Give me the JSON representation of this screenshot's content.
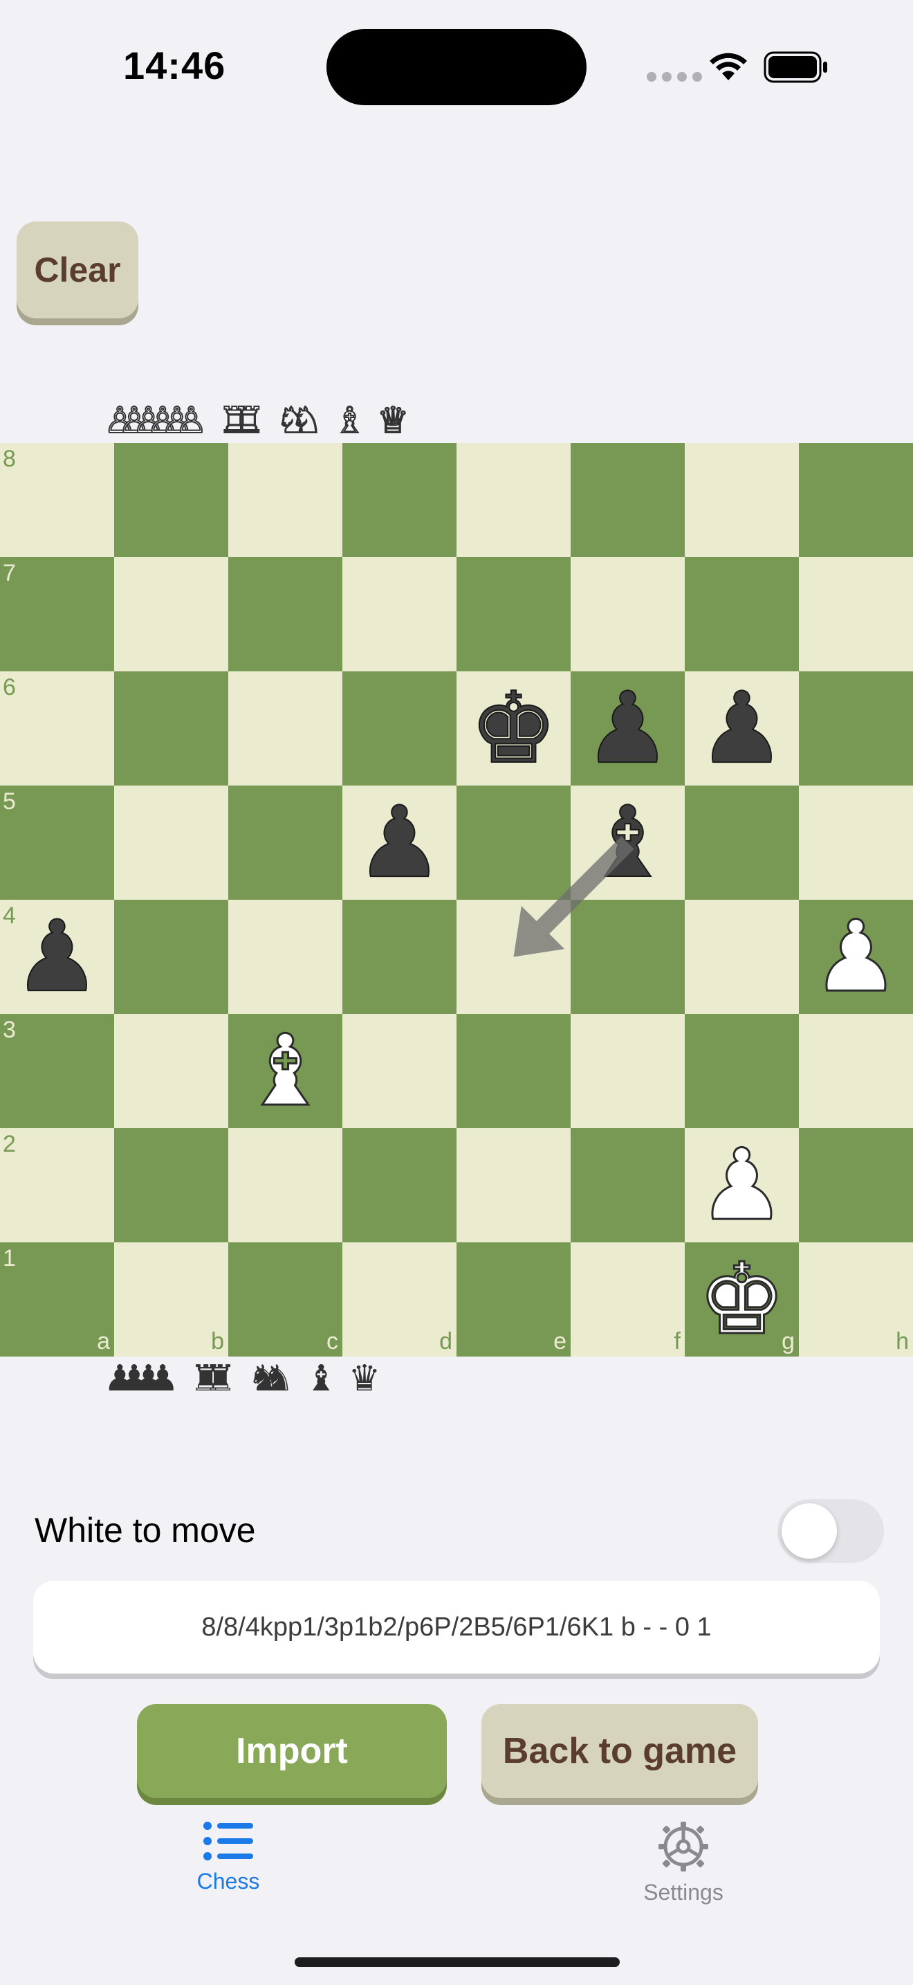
{
  "status_bar": {
    "time": "14:46"
  },
  "toolbar": {
    "clear_label": "Clear"
  },
  "captured": {
    "top": [
      {
        "symbol": "♙",
        "count": 6
      },
      {
        "symbol": "♖",
        "count": 2
      },
      {
        "symbol": "♘",
        "count": 2
      },
      {
        "symbol": "♗",
        "count": 1
      },
      {
        "symbol": "♕",
        "count": 1
      }
    ],
    "bottom": [
      {
        "symbol": "♟",
        "count": 4
      },
      {
        "symbol": "♜",
        "count": 2
      },
      {
        "symbol": "♞",
        "count": 2
      },
      {
        "symbol": "♝",
        "count": 1
      },
      {
        "symbol": "♛",
        "count": 1
      }
    ]
  },
  "board": {
    "fen_placement": "8/8/4kpp1/3p1b2/p6P/2B5/6P1/6K1",
    "ranks": [
      "8",
      "7",
      "6",
      "5",
      "4",
      "3",
      "2",
      "1"
    ],
    "files": [
      "a",
      "b",
      "c",
      "d",
      "e",
      "f",
      "g",
      "h"
    ],
    "last_move_arrow": {
      "from": "f5",
      "to": "e4"
    },
    "colors": {
      "light": "#ebebd0",
      "dark": "#779954"
    }
  },
  "controls": {
    "turn_label": "White to move",
    "toggle_on": false,
    "fen": "8/8/4kpp1/3p1b2/p6P/2B5/6P1/6K1 b - - 0 1",
    "import_label": "Import",
    "back_label": "Back to game"
  },
  "tab_bar": {
    "items": [
      {
        "label": "Chess",
        "icon": "list-icon",
        "active": true
      },
      {
        "label": "Settings",
        "icon": "gear-icon",
        "active": false
      }
    ]
  }
}
